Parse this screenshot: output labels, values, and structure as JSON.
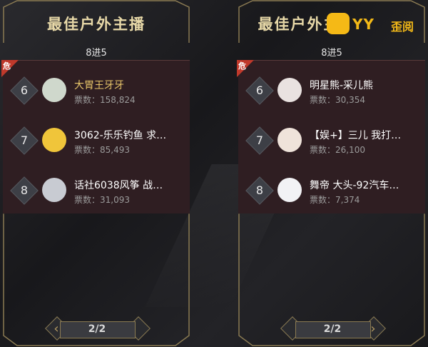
{
  "panels": [
    {
      "title": "最佳户外主播",
      "subtitle": "8进5",
      "badge": "危",
      "rows": [
        {
          "rank": "6",
          "name": "大胃王牙牙",
          "votes": "票数：158,824"
        },
        {
          "rank": "7",
          "name": "3062-乐乐钓鱼 求…",
          "votes": "票数：85,493"
        },
        {
          "rank": "8",
          "name": "话社6038风筝 战…",
          "votes": "票数：31,093"
        }
      ],
      "pager": "2/2"
    },
    {
      "title": "最佳户外主",
      "subtitle": "8进5",
      "badge": "危",
      "rows": [
        {
          "rank": "6",
          "name": "明星熊-采儿熊",
          "votes": "票数：30,354"
        },
        {
          "rank": "7",
          "name": "【娱+】三儿 我打…",
          "votes": "票数：26,100"
        },
        {
          "rank": "8",
          "name": "舞帝 大头-92汽车…",
          "votes": "票数：7,374"
        }
      ],
      "pager": "2/2"
    }
  ],
  "watermark": {
    "latin": "YY",
    "cn": "歪阅"
  },
  "colors": {
    "title": "#e8d9a8",
    "accent_gold": "#e8c66a",
    "danger": "#c0392b",
    "list_bg": "#2f1e22"
  }
}
